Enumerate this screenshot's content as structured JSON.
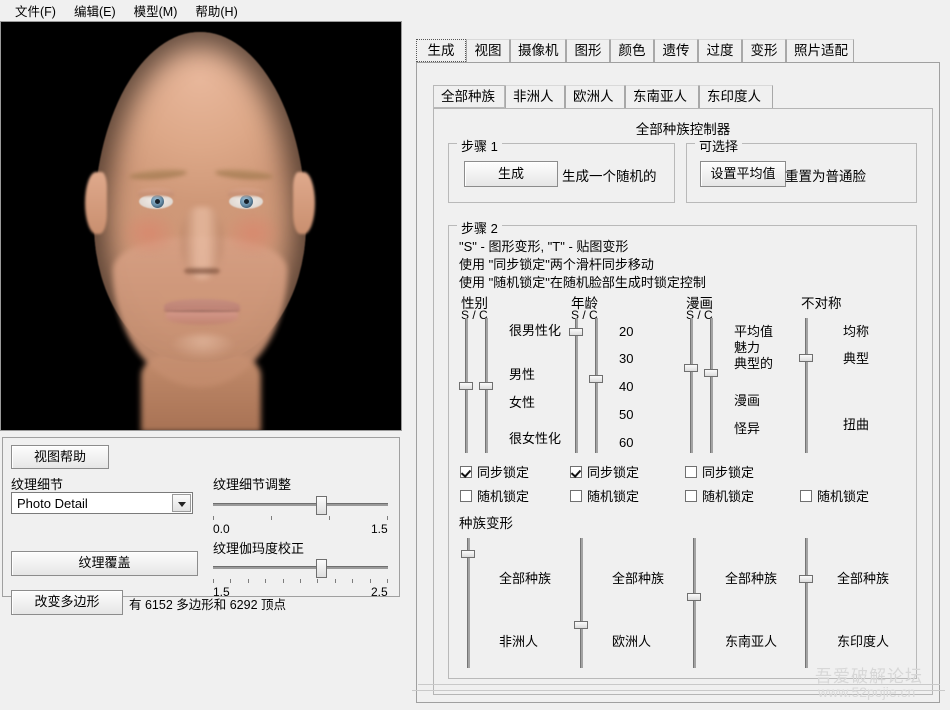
{
  "menu": {
    "items": [
      {
        "label": "文件(F)"
      },
      {
        "label": "编辑(E)"
      },
      {
        "label": "模型(M)"
      },
      {
        "label": "帮助(H)"
      }
    ]
  },
  "viewport": {
    "background": "#000000",
    "content": "3d-face-render"
  },
  "left_panel": {
    "view_help_button": "视图帮助",
    "texture_detail_label": "纹理细节",
    "texture_detail_value": "Photo Detail",
    "texture_detail_adjust": {
      "title": "纹理细节调整",
      "min": "0.0",
      "max": "1.5",
      "value": 0.93
    },
    "texture_gamma": {
      "title": "纹理伽玛度校正",
      "min": "1.5",
      "max": "2.5",
      "value": 2.12
    },
    "texture_overlay_button": "纹理覆盖",
    "change_poly_button": "改变多边形",
    "poly_info": "有 6152 多边形和 6292 顶点"
  },
  "tabs": [
    {
      "label": "生成",
      "selected": true
    },
    {
      "label": "视图",
      "selected": false
    },
    {
      "label": "摄像机",
      "selected": false
    },
    {
      "label": "图形",
      "selected": false
    },
    {
      "label": "颜色",
      "selected": false
    },
    {
      "label": "遗传",
      "selected": false
    },
    {
      "label": "过度",
      "selected": false
    },
    {
      "label": "变形",
      "selected": false
    },
    {
      "label": "照片适配",
      "selected": false
    }
  ],
  "subtabs": [
    {
      "label": "全部种族",
      "selected": true
    },
    {
      "label": "非洲人",
      "selected": false
    },
    {
      "label": "欧洲人",
      "selected": false
    },
    {
      "label": "东南亚人",
      "selected": false
    },
    {
      "label": "东印度人",
      "selected": false
    }
  ],
  "panel": {
    "controller_title": "全部种族控制器",
    "step1": {
      "group_label": "步骤 1",
      "generate_button": "生成",
      "generate_desc": "生成一个随机的"
    },
    "optional": {
      "group_label": "可选择",
      "set_average_button": "设置平均值",
      "set_average_desc": "重置为普通脸"
    },
    "step2": {
      "group_label": "步骤 2",
      "line1": "\"S\" - 图形变形, \"T\" - 贴图变形",
      "line2": "使用 \"同步锁定\"两个滑杆同步移动",
      "line3": "使用 \"随机锁定\"在随机脸部生成时锁定控制",
      "columns": [
        {
          "title": "性别",
          "subtitle": "S / C",
          "labels": [
            "很男性化",
            "男性",
            "女性",
            "很女性化"
          ],
          "slider_values": [
            0.5,
            0.5
          ],
          "sync_lock": {
            "label": "同步锁定",
            "checked": true
          },
          "random_lock": {
            "label": "随机锁定",
            "checked": false
          }
        },
        {
          "title": "年龄",
          "subtitle": "S / C",
          "labels": [
            "20",
            "30",
            "40",
            "50",
            "60"
          ],
          "slider_values": [
            0.08,
            0.45
          ],
          "sync_lock": {
            "label": "同步锁定",
            "checked": true
          },
          "random_lock": {
            "label": "随机锁定",
            "checked": false
          }
        },
        {
          "title": "漫画",
          "subtitle": "S / C",
          "labels": [
            "平均值",
            "魅力",
            "典型的",
            "漫画",
            "怪异"
          ],
          "slider_values": [
            0.36,
            0.4
          ],
          "sync_lock": {
            "label": "同步锁定",
            "checked": false
          },
          "random_lock": {
            "label": "随机锁定",
            "checked": false
          }
        },
        {
          "title": "不对称",
          "subtitle": "",
          "labels": [
            "均称",
            "典型",
            "扭曲"
          ],
          "slider_values": [
            0.28
          ],
          "sync_lock": null,
          "random_lock": {
            "label": "随机锁定",
            "checked": false
          }
        }
      ],
      "race_morph": {
        "title": "种族变形",
        "sliders": [
          {
            "top_label": "全部种族",
            "bottom_label": "非洲人",
            "value": 0.1
          },
          {
            "top_label": "全部种族",
            "bottom_label": "欧洲人",
            "value": 0.68
          },
          {
            "top_label": "全部种族",
            "bottom_label": "东南亚人",
            "value": 0.45
          },
          {
            "top_label": "全部种族",
            "bottom_label": "东印度人",
            "value": 0.3
          }
        ]
      }
    }
  },
  "watermark": {
    "line1": "吾爱破解论坛",
    "line2": "www.52pojie.cn"
  }
}
